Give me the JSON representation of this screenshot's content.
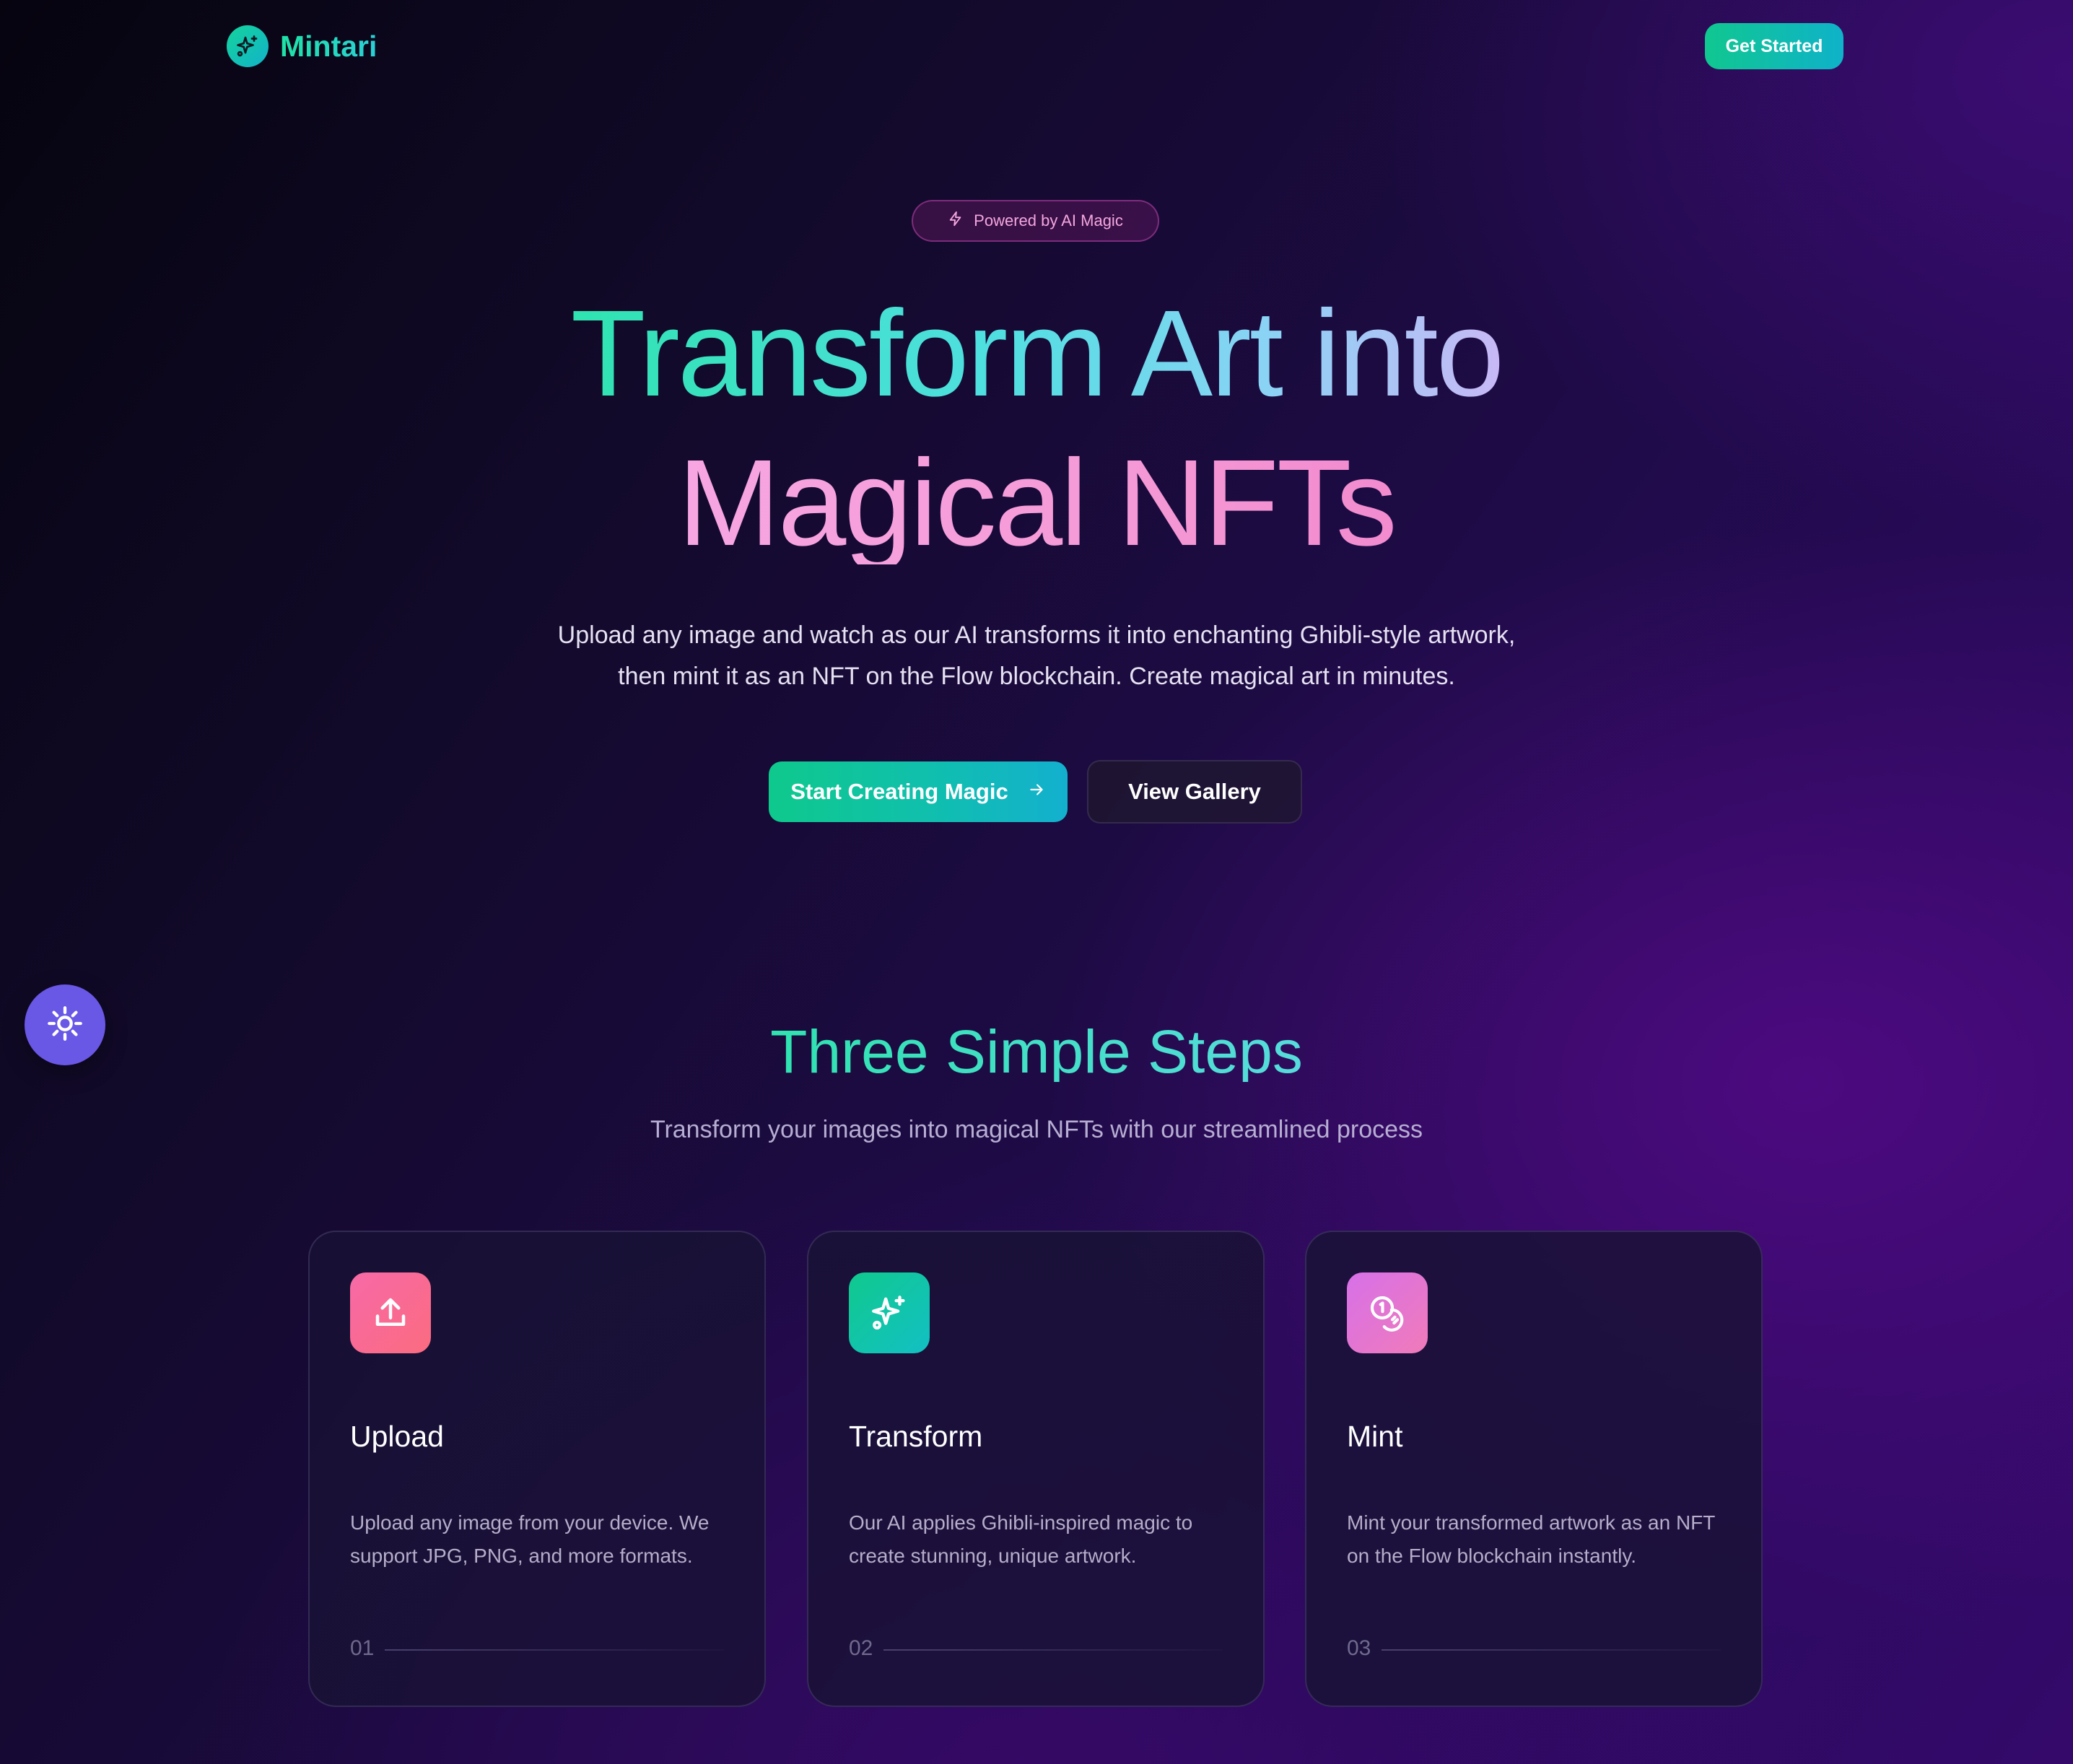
{
  "nav": {
    "brand_name": "Mintari",
    "brand_icon": "sparkles-icon",
    "cta_label": "Get Started"
  },
  "hero": {
    "badge_icon": "lightning-icon",
    "badge_text": "Powered by AI Magic",
    "title_line_1": "Transform Art into",
    "title_line_2": "Magical NFTs",
    "description": "Upload any image and watch as our AI transforms it into enchanting Ghibli-style artwork, then mint it as an NFT on the Flow blockchain. Create magical art in minutes.",
    "primary_button": "Start Creating Magic",
    "primary_button_icon": "arrow-right-icon",
    "secondary_button": "View Gallery"
  },
  "floating_button": {
    "icon": "sun-icon"
  },
  "steps": {
    "title": "Three Simple Steps",
    "subtitle": "Transform your images into magical NFTs with our streamlined process",
    "items": [
      {
        "icon": "upload-icon",
        "title": "Upload",
        "description": "Upload any image from your device. We support JPG, PNG, and more formats.",
        "number": "01"
      },
      {
        "icon": "sparkles-icon",
        "title": "Transform",
        "description": "Our AI applies Ghibli-inspired magic to create stunning, unique artwork.",
        "number": "02"
      },
      {
        "icon": "coins-icon",
        "title": "Mint",
        "description": "Mint your transformed artwork as an NFT on the Flow blockchain instantly.",
        "number": "03"
      }
    ]
  },
  "colors": {
    "accent_teal": "#10c790",
    "accent_cyan": "#13b0cf",
    "accent_pink": "#f59ad6",
    "fab_purple": "#6957e6"
  }
}
